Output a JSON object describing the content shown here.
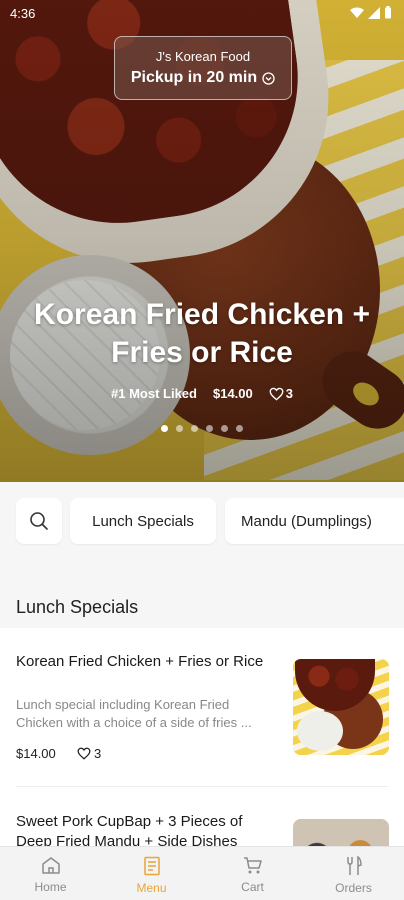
{
  "status_bar": {
    "time": "4:36"
  },
  "pickup": {
    "store_name": "J's Korean Food",
    "pickup_text": "Pickup in 20 min"
  },
  "hero": {
    "title_line1": "Korean Fried Chicken +",
    "title_line2": "Fries or Rice",
    "badge": "#1 Most Liked",
    "price": "$14.00",
    "likes": "3",
    "carousel_pages": 6,
    "carousel_active": 0
  },
  "categories": {
    "chips": [
      "Lunch Specials",
      "Mandu (Dumplings)"
    ]
  },
  "section": {
    "title": "Lunch Specials"
  },
  "items": [
    {
      "name": "Korean Fried Chicken + Fries or Rice",
      "description": "Lunch special including Korean Fried Chicken with a choice of a side of fries ...",
      "price": "$14.00",
      "likes": "3"
    },
    {
      "name": "Sweet Pork CupBap + 3 Pieces of Deep Fried Mandu + Side Dishes"
    }
  ],
  "nav": {
    "home": "Home",
    "menu": "Menu",
    "cart": "Cart",
    "orders": "Orders",
    "active": "menu"
  },
  "colors": {
    "accent": "#e8a53a",
    "inactive": "#8c8c8c"
  }
}
